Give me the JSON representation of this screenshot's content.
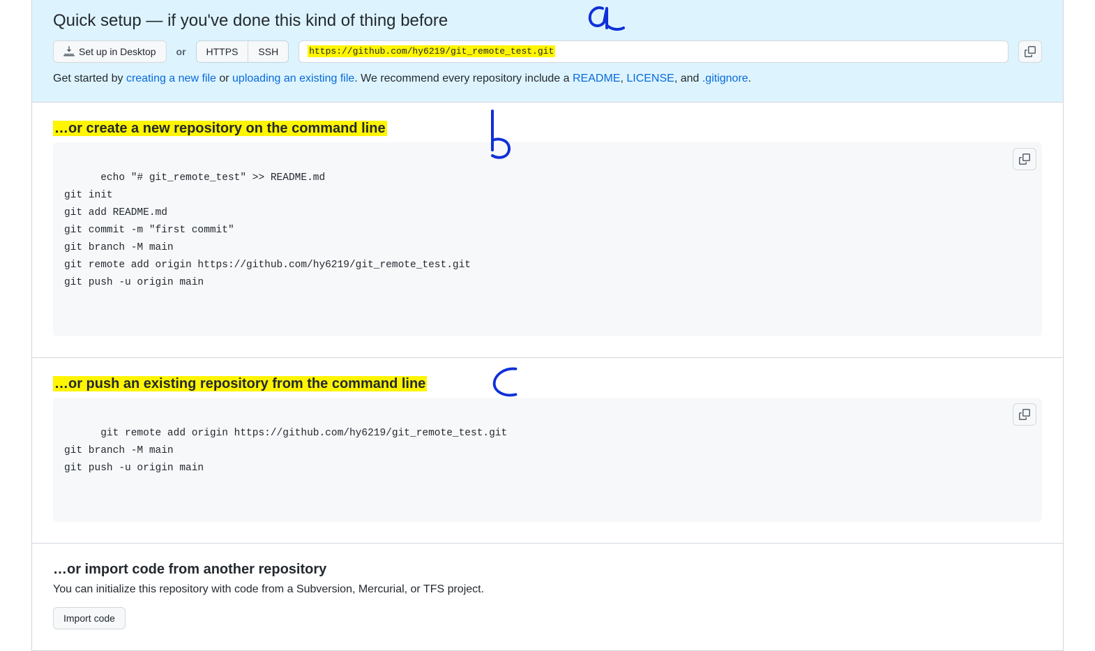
{
  "title": "Quick setup — if you've done this kind of thing before",
  "desktop_btn": "Set up in Desktop",
  "or_sep": "or",
  "proto_https": "HTTPS",
  "proto_ssh": "SSH",
  "repo_url": "https://github.com/hy6219/git_remote_test.git",
  "intro": {
    "pre": "Get started by ",
    "link_new": "creating a new file",
    "mid1": " or ",
    "link_upload": "uploading an existing file",
    "mid2": ". We recommend every repository include a ",
    "link_readme": "README",
    "comma1": ", ",
    "link_license": "LICENSE",
    "comma2": ", and ",
    "link_gitignore": ".gitignore",
    "period": "."
  },
  "create": {
    "heading": "…or create a new repository on the command line",
    "code": "echo \"# git_remote_test\" >> README.md\ngit init\ngit add README.md\ngit commit -m \"first commit\"\ngit branch -M main\ngit remote add origin https://github.com/hy6219/git_remote_test.git\ngit push -u origin main"
  },
  "push": {
    "heading": "…or push an existing repository from the command line",
    "code": "git remote add origin https://github.com/hy6219/git_remote_test.git\ngit branch -M main\ngit push -u origin main"
  },
  "import": {
    "heading": "…or import code from another repository",
    "desc": "You can initialize this repository with code from a Subversion, Mercurial, or TFS project.",
    "btn": "Import code"
  }
}
